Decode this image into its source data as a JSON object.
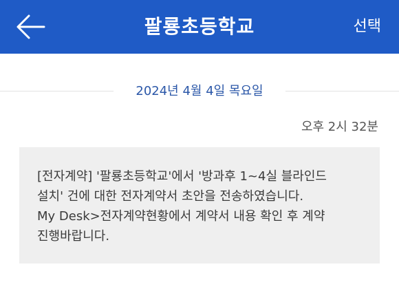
{
  "header": {
    "title": "팔룡초등학교",
    "action_label": "선택",
    "back_icon": "arrow-left-icon",
    "background_color": "#1f5bc6"
  },
  "conversation": {
    "date": "2024년 4월 4일 목요일",
    "message": {
      "time": "오후 2시 32분",
      "lines": [
        "[전자계약] '팔룡초등학교'에서 '방과후 1~4실 블라인드",
        "설치' 건에 대한 전자계약서 초안을 전송하였습니다.",
        "My Desk>전자계약현황에서 계약서 내용 확인 후 계약",
        "진행바랍니다."
      ]
    }
  }
}
